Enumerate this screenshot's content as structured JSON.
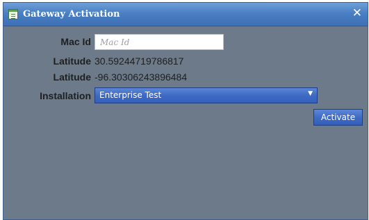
{
  "window": {
    "title": "Gateway Activation",
    "close_glyph": "✕",
    "title_icon": "form-icon",
    "close_icon": "close-icon"
  },
  "form": {
    "mac_id": {
      "label": "Mac Id",
      "value": "",
      "placeholder": "Mac Id"
    },
    "latitude": {
      "label": "Latitude",
      "value": "30.59244719786817"
    },
    "longitude": {
      "label": "Latitude",
      "value": "-96.30306243896484"
    },
    "installation": {
      "label": "Installation",
      "selected": "Enterprise Test"
    },
    "activate_label": "Activate"
  },
  "colors": {
    "title_bar": "#4a7fc3",
    "dialog_body": "#6c7a8a",
    "control_accent": "#3f6ac4"
  }
}
